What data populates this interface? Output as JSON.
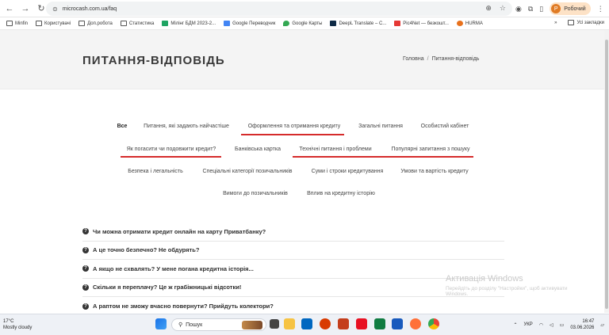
{
  "browser": {
    "url": "microcash.com.ua/faq",
    "profile_label": "Робочий",
    "profile_initial": "Р"
  },
  "bookmarks": [
    {
      "label": "Minfin",
      "icon": "folder-icon"
    },
    {
      "label": "Користувачі",
      "icon": "folder-icon"
    },
    {
      "label": "Доп.робота",
      "icon": "folder-icon"
    },
    {
      "label": "Статистика",
      "icon": "folder-icon"
    },
    {
      "label": "Мілінг БДМ 2023-2...",
      "icon": "sheets-icon"
    },
    {
      "label": "Google Переводчик",
      "icon": "translate-icon"
    },
    {
      "label": "Google Карты",
      "icon": "maps-icon"
    },
    {
      "label": "DeepL Translate – С...",
      "icon": "deepl-icon"
    },
    {
      "label": "Pic4Net — безкошт...",
      "icon": "pic4net-icon"
    },
    {
      "label": "HURMA",
      "icon": "hurma-icon"
    }
  ],
  "bookmarks_overflow": "»",
  "bookmarks_all": "Усі закладки",
  "header": {
    "title": "ПИТАННЯ-ВІДПОВІДЬ",
    "breadcrumb_home": "Головна",
    "breadcrumb_sep": "/",
    "breadcrumb_current": "Питання-відповідь"
  },
  "filters": {
    "row1": [
      "Все",
      "Питання, які задають найчастіше",
      "Оформлення та отримання кредиту",
      "Загальні питання",
      "Особистий кабінет"
    ],
    "row2": [
      "Як погасити чи подовжити кредит?",
      "Банківська картка",
      "Технічні питання і проблеми",
      "Популярні запитання з пошуку"
    ],
    "row3": [
      "Безпека і легальність",
      "Спеціальні категорії позичальників",
      "Суми і строки кредитування",
      "Умови та вартість кредиту"
    ],
    "row4": [
      "Вимоги до позичальників",
      "Вплив на кредитну історію"
    ],
    "active": "Все"
  },
  "faq": [
    "Чи можна отримати кредит онлайн на карту Приватбанку?",
    "А це точно безпечно? Не обдурять?",
    "А якщо не схвалять? У мене погана кредитна історія...",
    "Скільки я переплачу? Це ж грабіжницькі відсотки!",
    "А раптом не зможу вчасно повернути? Прийдуть колектори?"
  ],
  "watermark": {
    "line1": "Активація Windows",
    "line2": "Перейдіть до розділу \"Настройки\", щоб активувати",
    "line3": "Windows."
  },
  "taskbar": {
    "weather_temp": "17°C",
    "weather_desc": "Mostly cloudy",
    "search_placeholder": "Пошук",
    "lang": "УКР",
    "time": "16:47",
    "date": "03.06.2026"
  },
  "colors": {
    "underline": "#d52b2b",
    "header_bg": "#f4f4f4",
    "profile_bg": "#fde2c6"
  }
}
